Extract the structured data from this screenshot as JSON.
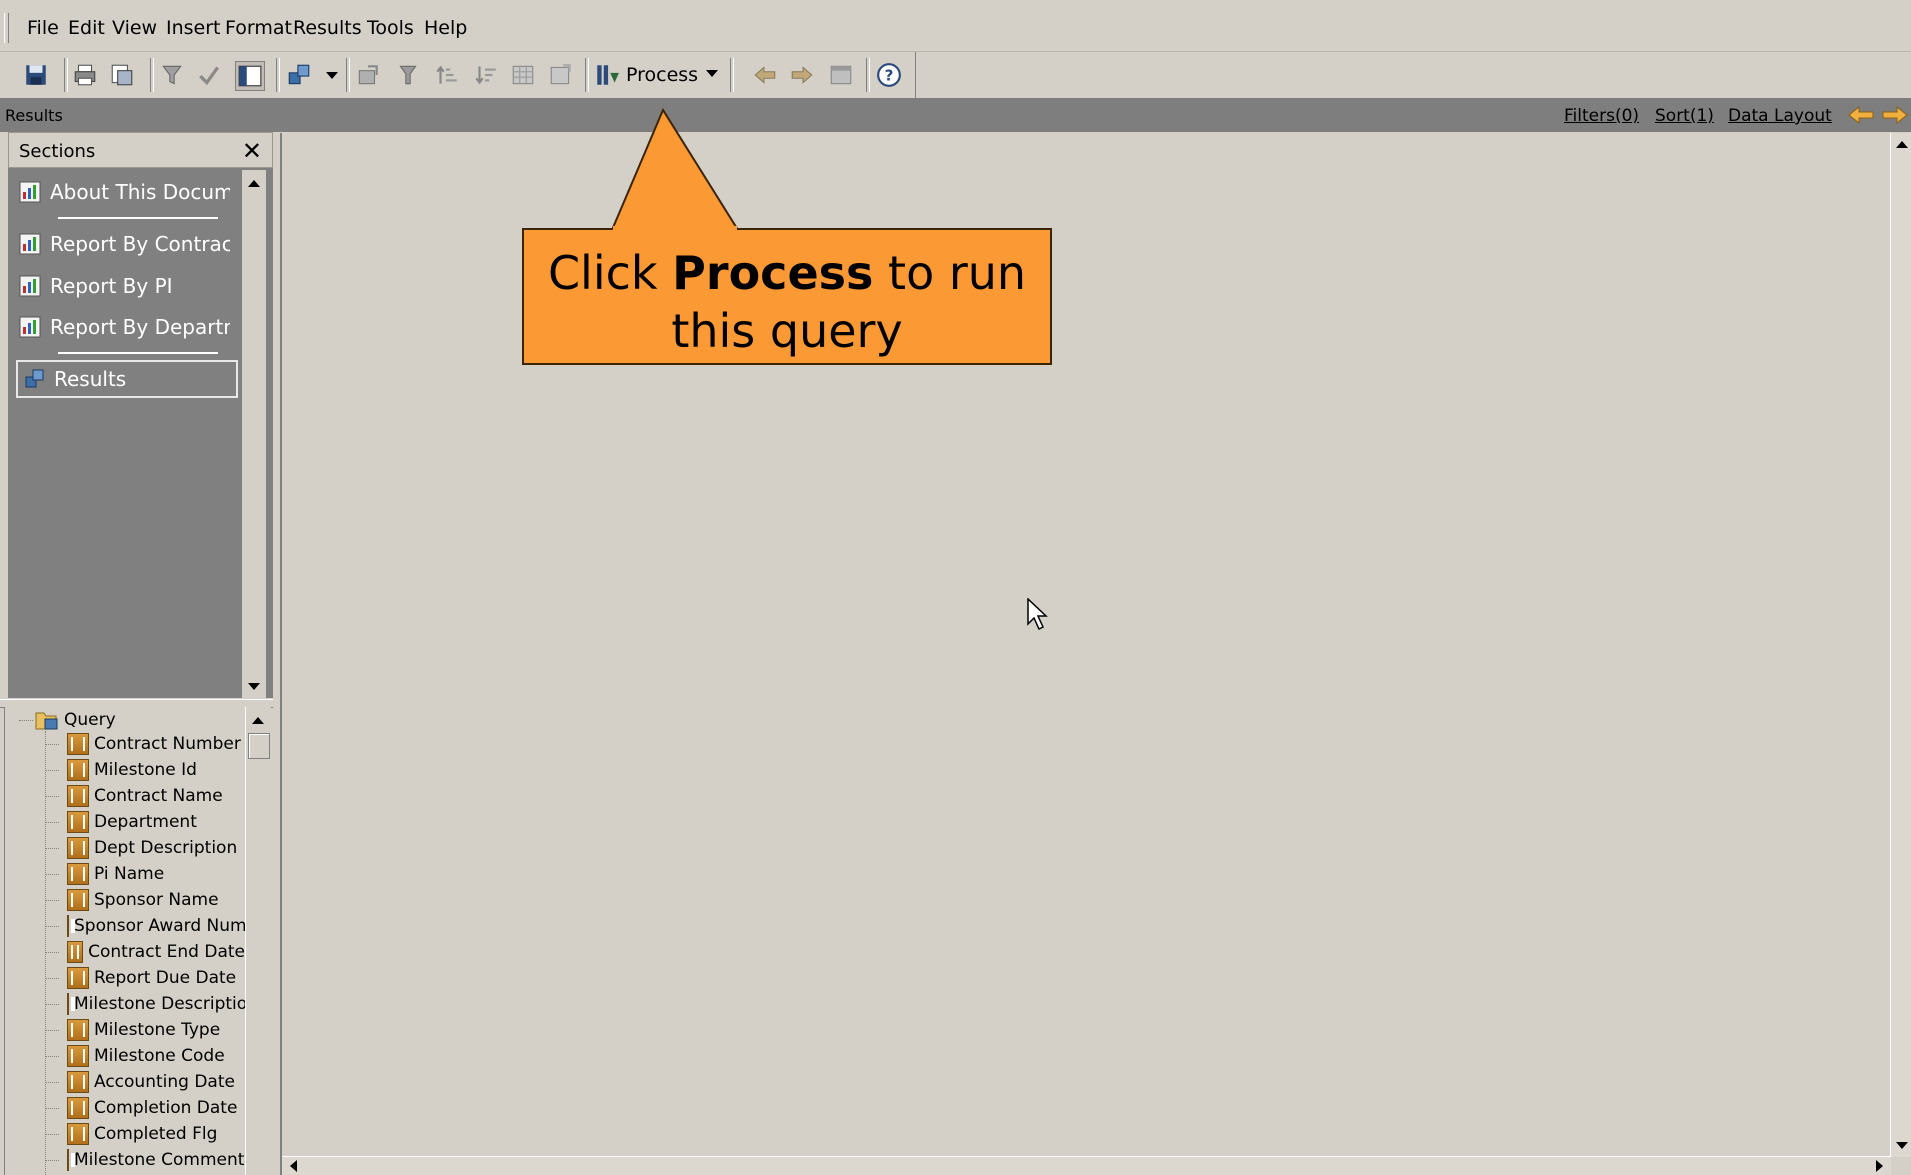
{
  "menubar": {
    "items": [
      "File",
      "Edit",
      "View",
      "Insert",
      "Format",
      "Results",
      "Tools",
      "Help"
    ]
  },
  "toolbar": {
    "process_label": "Process"
  },
  "titlestrip": {
    "title": "Results",
    "filters": "Filters(0)",
    "sort": "Sort(1)",
    "data_layout": "Data Layout"
  },
  "sections": {
    "header": "Sections",
    "close": "✕",
    "items": [
      {
        "label": "About This Document",
        "icon": "report-icon"
      },
      {
        "label": "Report By Contract",
        "icon": "report-icon"
      },
      {
        "label": "Report By PI",
        "icon": "report-icon"
      },
      {
        "label": "Report By Department",
        "icon": "report-icon"
      },
      {
        "label": "Results",
        "icon": "results-icon",
        "selected": true
      }
    ]
  },
  "query_tree": {
    "root": "Query",
    "columns": [
      "Contract Number",
      "Milestone Id",
      "Contract Name",
      "Department",
      "Dept Description",
      "Pi Name",
      "Sponsor Name",
      "Sponsor Award Number",
      "Contract End Date",
      "Report Due Date",
      "Milestone Description",
      "Milestone Type",
      "Milestone Code",
      "Accounting Date",
      "Completion Date",
      "Completed Flg",
      "Milestone Comments"
    ]
  },
  "callout": {
    "prefix": "Click ",
    "bold": "Process",
    "suffix_line1": " to run",
    "line2": "this query"
  },
  "colors": {
    "callout_fill": "#fb9a35",
    "panel_gray": "#808080",
    "window_bg": "#d4d0c8"
  }
}
